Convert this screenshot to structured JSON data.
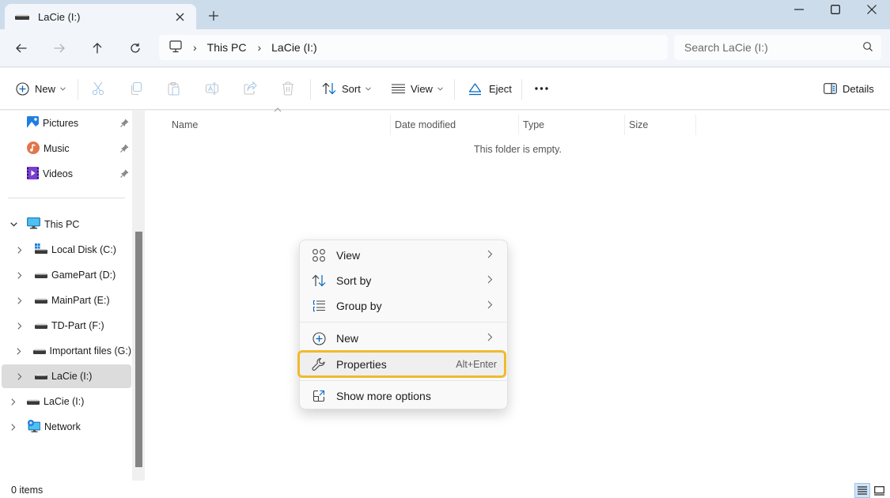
{
  "window": {
    "tab_title": "LaCie (I:)",
    "tab_icon": "drive-icon",
    "controls": [
      "minimize-icon",
      "maximize-icon",
      "close-icon"
    ]
  },
  "navigation": {
    "back_icon": "arrow-left-icon",
    "forward_icon": "arrow-right-icon",
    "up_icon": "arrow-up-icon",
    "refresh_icon": "refresh-icon",
    "breadcrumb": [
      "This PC",
      "LaCie (I:)"
    ],
    "breadcrumb_root_icon": "monitor-icon",
    "search_placeholder": "Search LaCie (I:)"
  },
  "commandbar": {
    "new_label": "New",
    "sort_label": "Sort",
    "view_label": "View",
    "eject_label": "Eject",
    "details_label": "Details",
    "disabled_actions": [
      "cut-icon",
      "copy-icon",
      "paste-icon",
      "rename-icon",
      "share-icon",
      "delete-icon"
    ],
    "more_icon": "more-icon"
  },
  "sidebar": {
    "quick_access": [
      {
        "label": "Pictures",
        "icon": "pictures-icon",
        "pinned": true
      },
      {
        "label": "Music",
        "icon": "music-icon",
        "pinned": true
      },
      {
        "label": "Videos",
        "icon": "videos-icon",
        "pinned": true
      }
    ],
    "this_pc": {
      "label": "This PC",
      "expanded": true,
      "drives": [
        {
          "label": "Local Disk (C:)",
          "icon": "windows-drive-icon"
        },
        {
          "label": "GamePart (D:)",
          "icon": "drive-icon"
        },
        {
          "label": "MainPart (E:)",
          "icon": "drive-icon"
        },
        {
          "label": "TD-Part (F:)",
          "icon": "drive-icon"
        },
        {
          "label": "Important files (G:)",
          "icon": "drive-icon"
        },
        {
          "label": "LaCie (I:)",
          "icon": "drive-icon",
          "selected": true
        }
      ]
    },
    "root_items": [
      {
        "label": "LaCie (I:)",
        "icon": "drive-icon"
      },
      {
        "label": "Network",
        "icon": "network-icon"
      }
    ]
  },
  "content": {
    "columns": [
      "Name",
      "Date modified",
      "Type",
      "Size"
    ],
    "empty_message": "This folder is empty."
  },
  "context_menu": {
    "items": [
      {
        "label": "View",
        "icon": "grid-icon",
        "submenu": true
      },
      {
        "label": "Sort by",
        "icon": "sort-icon",
        "submenu": true
      },
      {
        "label": "Group by",
        "icon": "group-icon",
        "submenu": true
      },
      {
        "label": "New",
        "icon": "plus-circle-icon",
        "submenu": true
      },
      {
        "label": "Properties",
        "icon": "wrench-icon",
        "shortcut": "Alt+Enter",
        "highlighted": true
      },
      {
        "label": "Show more options",
        "icon": "open-external-icon"
      }
    ]
  },
  "statusbar": {
    "item_count": "0 items",
    "view_modes": [
      "details-view-icon",
      "tiles-view-icon"
    ],
    "active_view": "details-view-icon"
  },
  "colors": {
    "accent": "#0067c0",
    "highlight_outline": "#f0b92e",
    "titlebar": "#cddceb"
  }
}
